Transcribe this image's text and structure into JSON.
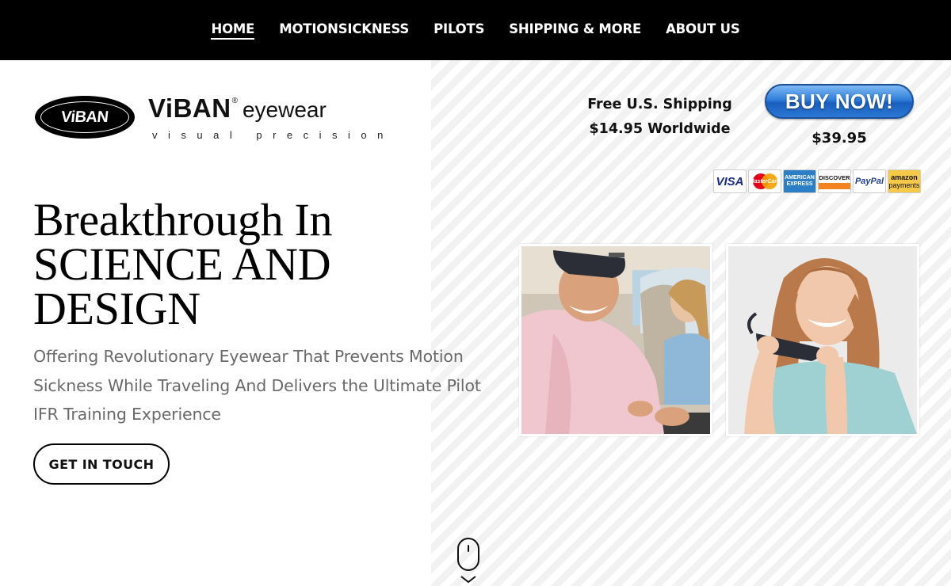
{
  "nav": {
    "items": [
      {
        "label": "HOME",
        "active": true
      },
      {
        "label": "MOTIONSICKNESS",
        "active": false
      },
      {
        "label": "PILOTS",
        "active": false
      },
      {
        "label": "SHIPPING & MORE",
        "active": false
      },
      {
        "label": "ABOUT US",
        "active": false
      }
    ]
  },
  "logo": {
    "oval_text": "ViBAN",
    "brand": "ViBAN",
    "registered": "®",
    "product": "eyewear",
    "tagline": "visual precision"
  },
  "hero": {
    "title_lines": [
      "Breakthrough In",
      "SCIENCE AND",
      "DESIGN"
    ],
    "subtitle_lines": [
      "Offering Revolutionary Eyewear That Prevents Motion",
      "Sickness While Traveling And Delivers the Ultimate Pilot",
      "IFR Training Experience"
    ],
    "cta_label": "GET IN TOUCH"
  },
  "shipping": {
    "line1": "Free U.S. Shipping",
    "line2": "$14.95 Worldwide"
  },
  "buy": {
    "label": "BUY NOW!",
    "price": "$39.95",
    "color": "#2f7fd9"
  },
  "payments": {
    "visa": "VISA",
    "mastercard": "MasterCard",
    "amex": "AMERICAN EXPRESS",
    "discover": "DISCOVER",
    "paypal": "PayPal",
    "amazon_line1": "amazon",
    "amazon_line2": "payments"
  },
  "icons": {
    "scroll": "mouse-scroll-icon",
    "chevron": "chevron-down-icon"
  }
}
